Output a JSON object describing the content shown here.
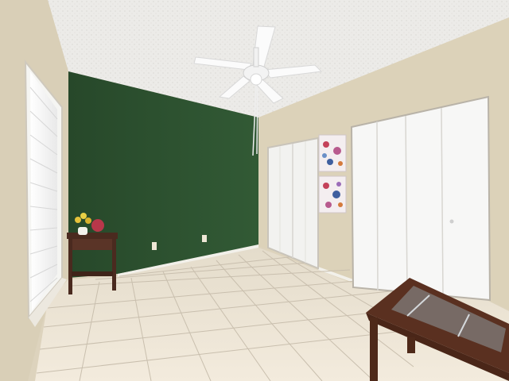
{
  "scene": {
    "ceiling_fan": {
      "icon": "ceiling-fan-icon",
      "blades": 5
    },
    "accent_wall_color": "#2e5230",
    "beige_wall_color": "#ddd3bd",
    "ceiling_color": "#ecebe8",
    "floor_tile_color": "#efe6d6",
    "window": {
      "icon": "window-icon",
      "blinds": true
    },
    "closets": [
      {
        "name": "small-closet",
        "doors": 2,
        "color": "#f7f7f6"
      },
      {
        "name": "large-closet",
        "doors": 4,
        "color": "#f7f7f6"
      }
    ],
    "artworks": 2,
    "furniture": [
      "side-table",
      "glass-top-table"
    ]
  }
}
